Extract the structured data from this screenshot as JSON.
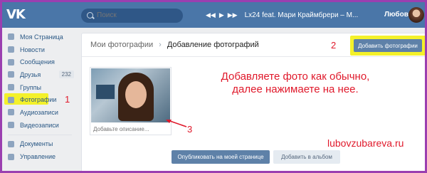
{
  "topbar": {
    "logo": "VK",
    "search_placeholder": "Поиск",
    "player": {
      "prev": "◀◀",
      "play": "▶",
      "next": "▶▶",
      "track": "Lx24 feat. Мари Краймбрери – М..."
    },
    "username": "Любовь"
  },
  "sidebar": {
    "items": [
      {
        "label": "Моя Страница",
        "icon": "home-icon"
      },
      {
        "label": "Новости",
        "icon": "news-icon"
      },
      {
        "label": "Сообщения",
        "icon": "messages-icon"
      },
      {
        "label": "Друзья",
        "icon": "friends-icon",
        "badge": "232"
      },
      {
        "label": "Группы",
        "icon": "groups-icon"
      },
      {
        "label": "Фотографии",
        "icon": "photos-icon"
      },
      {
        "label": "Аудиозаписи",
        "icon": "audio-icon"
      },
      {
        "label": "Видеозаписи",
        "icon": "video-icon"
      },
      {
        "label": "Документы",
        "icon": "documents-icon"
      },
      {
        "label": "Управление",
        "icon": "manage-icon"
      }
    ]
  },
  "breadcrumb": {
    "parent": "Мои фотографии",
    "separator": "›",
    "current": "Добавление фотографий"
  },
  "buttons": {
    "add_photos": "Добавить фотографии",
    "publish": "Опубликовать на моей странице",
    "add_to_album": "Добавить в альбом"
  },
  "photo": {
    "caption_placeholder": "Добавьте описание..."
  },
  "annotations": {
    "num1": "1",
    "num2": "2",
    "num3": "3",
    "instruction_line1": "Добавляете фото как обычно,",
    "instruction_line2": "далее нажимаете на нее.",
    "site": "lubovzubareva.ru",
    "color": "#e0192b",
    "highlight_color": "#f4f12a"
  }
}
